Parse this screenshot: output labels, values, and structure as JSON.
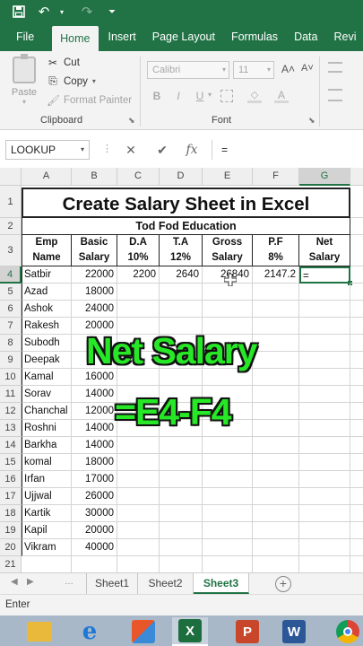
{
  "ribbon": {
    "tabs": [
      {
        "label": "File"
      },
      {
        "label": "Home"
      },
      {
        "label": "Insert"
      },
      {
        "label": "Page Layout"
      },
      {
        "label": "Formulas"
      },
      {
        "label": "Data"
      },
      {
        "label": "Revi"
      }
    ],
    "active_tab": "Home",
    "clipboard": {
      "paste": "Paste",
      "cut": "Cut",
      "copy": "Copy",
      "format_painter": "Format Painter",
      "group_label": "Clipboard"
    },
    "font": {
      "font_name": "Calibri",
      "font_size": "11",
      "bold": "B",
      "italic": "I",
      "underline": "U",
      "grow": "A˄",
      "shrink": "A˅",
      "group_label": "Font"
    }
  },
  "formula_bar": {
    "name_box": "LOOKUP",
    "cancel": "✕",
    "enter": "✔",
    "fx": "fx",
    "content": "="
  },
  "columns": [
    "A",
    "B",
    "C",
    "D",
    "E",
    "F",
    "G"
  ],
  "rows": [
    "1",
    "2",
    "3",
    "4",
    "5",
    "6",
    "7",
    "8",
    "9",
    "10",
    "11",
    "12",
    "13",
    "14",
    "15",
    "16",
    "17",
    "18",
    "19",
    "20",
    "21"
  ],
  "sheet": {
    "title": "Create Salary Sheet in Excel",
    "subtitle": "Tod Fod Education",
    "headers": [
      [
        "Emp",
        "Name"
      ],
      [
        "Basic",
        "Salary"
      ],
      [
        "D.A",
        "10%"
      ],
      [
        "T.A",
        "12%"
      ],
      [
        "Gross",
        "Salary"
      ],
      [
        "P.F",
        "8%"
      ],
      [
        "Net",
        "Salary"
      ]
    ],
    "row4": {
      "c": "2200",
      "d": "2640",
      "e": "26840",
      "f": "2147.2",
      "g": "="
    },
    "employees": [
      {
        "name": "Satbir",
        "basic": "22000"
      },
      {
        "name": "Azad",
        "basic": "18000"
      },
      {
        "name": "Ashok",
        "basic": "24000"
      },
      {
        "name": "Rakesh",
        "basic": "20000"
      },
      {
        "name": "Subodh",
        "basic": ""
      },
      {
        "name": "Deepak",
        "basic": ""
      },
      {
        "name": "Kamal",
        "basic": "16000"
      },
      {
        "name": "Sorav",
        "basic": "14000"
      },
      {
        "name": "Chanchal",
        "basic": "12000"
      },
      {
        "name": "Roshni",
        "basic": "14000"
      },
      {
        "name": "Barkha",
        "basic": "14000"
      },
      {
        "name": "komal",
        "basic": "18000"
      },
      {
        "name": "Irfan",
        "basic": "17000"
      },
      {
        "name": "Ujjwal",
        "basic": "26000"
      },
      {
        "name": "Kartik",
        "basic": "30000"
      },
      {
        "name": "Kapil",
        "basic": "20000"
      },
      {
        "name": "Vikram",
        "basic": "40000"
      }
    ]
  },
  "overlay": {
    "line1": "Net Salary",
    "line2": "=E4-F4"
  },
  "sheet_tabs": [
    "Sheet1",
    "Sheet2",
    "Sheet3"
  ],
  "active_sheet": "Sheet3",
  "status": "Enter",
  "taskbar": {
    "apps": [
      {
        "icon": "file-explorer-icon",
        "letter": ""
      },
      {
        "icon": "internet-explorer-icon",
        "letter": "e"
      },
      {
        "icon": "control-panel-icon",
        "letter": ""
      },
      {
        "icon": "excel-icon",
        "letter": "X"
      },
      {
        "icon": "powerpoint-icon",
        "letter": "P"
      },
      {
        "icon": "word-icon",
        "letter": "W"
      },
      {
        "icon": "chrome-icon",
        "letter": ""
      }
    ]
  },
  "colors": {
    "excel_green": "#217346",
    "overlay_green": "#27e827",
    "taskbar": "#a9b8c9"
  }
}
